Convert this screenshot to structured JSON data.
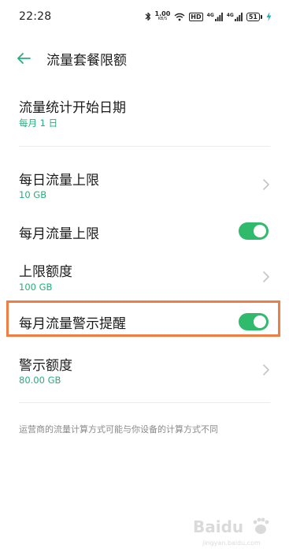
{
  "status_bar": {
    "time": "22:28",
    "network_speed_value": "1.00",
    "network_speed_unit": "KB/S",
    "hd_label": "HD",
    "signal_1_label": "4G",
    "signal_2_label": "4G",
    "battery_level": "51",
    "icons": [
      "bluetooth-icon",
      "wifi-icon",
      "signal-icon",
      "battery-icon",
      "charging-icon"
    ]
  },
  "header": {
    "title": "流量套餐限额",
    "back_icon": "back-arrow-icon"
  },
  "settings": {
    "start_date": {
      "title": "流量统计开始日期",
      "value": "每月 1 日"
    },
    "daily_limit": {
      "title": "每日流量上限",
      "value": "10 GB"
    },
    "monthly_limit_toggle": {
      "title": "每月流量上限",
      "enabled": true
    },
    "limit_quota": {
      "title": "上限额度",
      "value": "100 GB"
    },
    "monthly_warning_toggle": {
      "title": "每月流量警示提醒",
      "enabled": true
    },
    "warning_quota": {
      "title": "警示额度",
      "value": "80.00 GB"
    }
  },
  "footnote": "运营商的流量计算方式可能与你设备的计算方式不同",
  "colors": {
    "accent_green": "#23b07a",
    "toggle_on": "#2fba6c",
    "highlight_border": "#f07d43",
    "back_arrow": "#23b07a"
  },
  "watermark": {
    "brand": "Baidu",
    "subtext": "jingyan.baidu.com"
  }
}
